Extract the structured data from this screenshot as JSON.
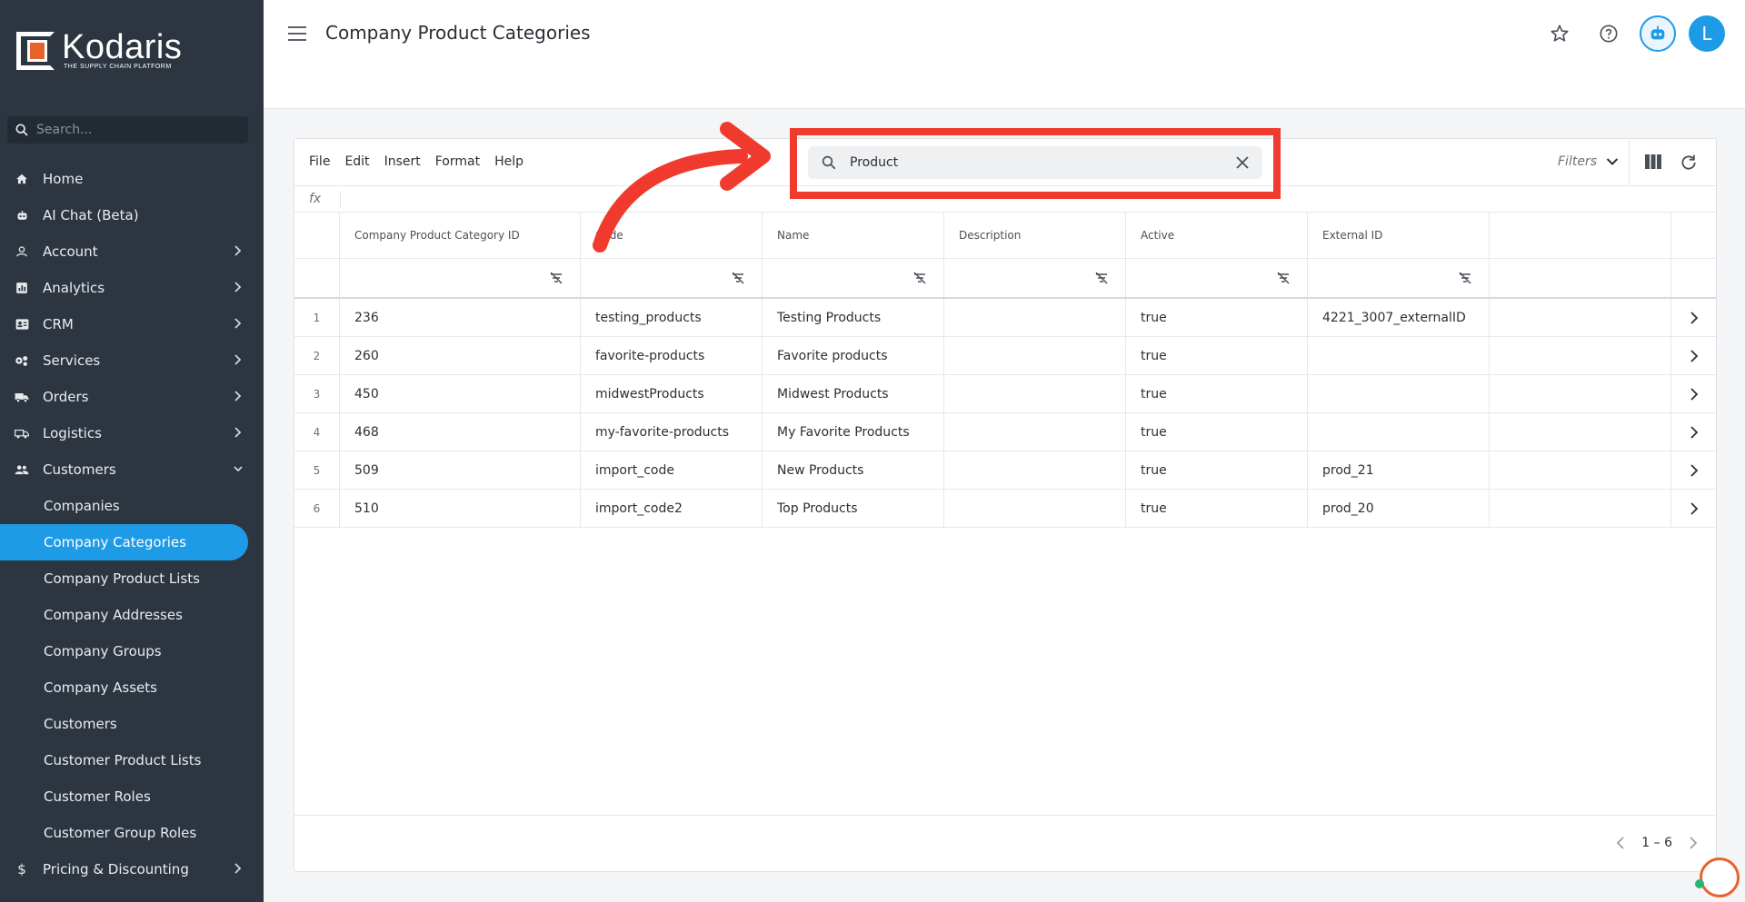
{
  "brand": {
    "name": "Kodaris",
    "tagline": "THE SUPPLY CHAIN PLATFORM",
    "accent": "#1e9be6",
    "logo_orange": "#e8632b"
  },
  "sidebar": {
    "search_placeholder": "Search...",
    "items": [
      {
        "label": "Home",
        "icon": "home-icon",
        "expandable": false
      },
      {
        "label": "AI Chat (Beta)",
        "icon": "robot-icon",
        "expandable": false
      },
      {
        "label": "Account",
        "icon": "person-icon",
        "expandable": true
      },
      {
        "label": "Analytics",
        "icon": "chart-icon",
        "expandable": true
      },
      {
        "label": "CRM",
        "icon": "contact-card-icon",
        "expandable": true
      },
      {
        "label": "Services",
        "icon": "services-icon",
        "expandable": true
      },
      {
        "label": "Orders",
        "icon": "truck-icon",
        "expandable": true
      },
      {
        "label": "Logistics",
        "icon": "delivery-icon",
        "expandable": true
      },
      {
        "label": "Customers",
        "icon": "people-icon",
        "expandable": true,
        "expanded": true
      }
    ],
    "sub_items": [
      "Companies",
      "Company Categories",
      "Company Product Lists",
      "Company Addresses",
      "Company Groups",
      "Company Assets",
      "Customers",
      "Customer Product Lists",
      "Customer Roles",
      "Customer Group Roles"
    ],
    "active_sub_item": "Company Categories",
    "after_items": [
      {
        "label": "Pricing & Discounting",
        "icon": "dollar-icon",
        "expandable": true
      }
    ]
  },
  "header": {
    "title": "Company Product Categories",
    "avatar_initial": "L"
  },
  "toolbar": {
    "menus": [
      "File",
      "Edit",
      "Insert",
      "Format",
      "Help"
    ],
    "search_value": "Product",
    "filters_label": "Filters"
  },
  "formula": {
    "fx": "fx"
  },
  "table": {
    "columns": [
      "Company Product Category ID",
      "Code",
      "Name",
      "Description",
      "Active",
      "External ID"
    ],
    "rows": [
      {
        "n": "1",
        "id": "236",
        "code": "testing_products",
        "name": "Testing Products",
        "description": "",
        "active": "true",
        "external_id": "4221_3007_externalID"
      },
      {
        "n": "2",
        "id": "260",
        "code": "favorite-products",
        "name": "Favorite products",
        "description": "",
        "active": "true",
        "external_id": ""
      },
      {
        "n": "3",
        "id": "450",
        "code": "midwestProducts",
        "name": "Midwest Products",
        "description": "",
        "active": "true",
        "external_id": ""
      },
      {
        "n": "4",
        "id": "468",
        "code": "my-favorite-products",
        "name": "My Favorite Products",
        "description": "",
        "active": "true",
        "external_id": ""
      },
      {
        "n": "5",
        "id": "509",
        "code": "import_code",
        "name": "New Products",
        "description": "",
        "active": "true",
        "external_id": "prod_21"
      },
      {
        "n": "6",
        "id": "510",
        "code": "import_code2",
        "name": "Top Products",
        "description": "",
        "active": "true",
        "external_id": "prod_20"
      }
    ]
  },
  "pagination": {
    "range": "1 – 6"
  },
  "annotation": {
    "color": "#f03a2e"
  }
}
